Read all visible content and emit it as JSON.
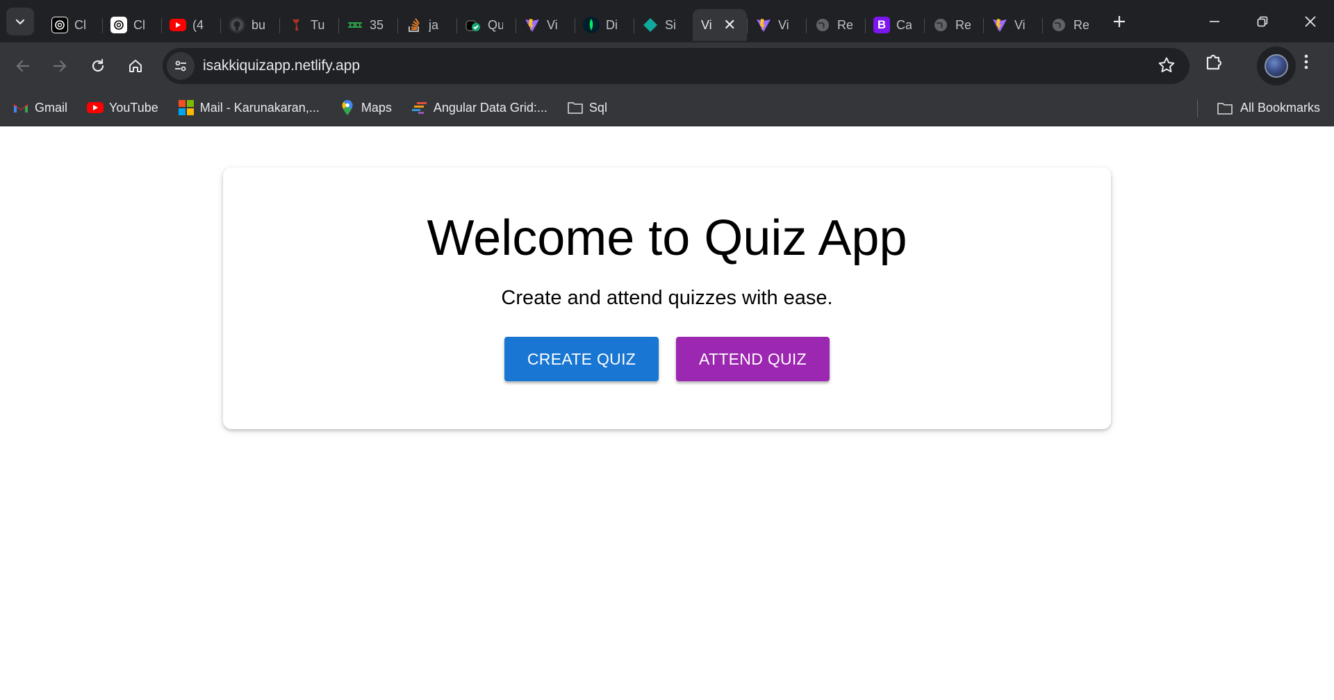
{
  "browser": {
    "tabs": [
      {
        "title": "Cl",
        "icon": "chatgpt-icon"
      },
      {
        "title": "Cl",
        "icon": "chatgpt-icon"
      },
      {
        "title": "(4",
        "icon": "youtube-icon"
      },
      {
        "title": "bu",
        "icon": "github-icon"
      },
      {
        "title": "Tu",
        "icon": "tutorial-site-icon"
      },
      {
        "title": "35",
        "icon": "leetcode-icon"
      },
      {
        "title": "ja",
        "icon": "stackoverflow-icon"
      },
      {
        "title": "Qu",
        "icon": "quiz-site-icon"
      },
      {
        "title": "Vi",
        "icon": "vite-icon"
      },
      {
        "title": "Di",
        "icon": "mongodb-icon"
      },
      {
        "title": "Si",
        "icon": "diamond-site-icon"
      },
      {
        "title": "Vi",
        "icon": "none",
        "active": true
      },
      {
        "title": "Vi",
        "icon": "vite-icon"
      },
      {
        "title": "Re",
        "icon": "globe-icon"
      },
      {
        "title": "Ca",
        "icon": "bootstrap-icon",
        "badge": "B"
      },
      {
        "title": "Re",
        "icon": "globe-icon"
      },
      {
        "title": "Vi",
        "icon": "vite-icon"
      },
      {
        "title": "Re",
        "icon": "globe-icon"
      }
    ],
    "address": {
      "url": "isakkiquizapp.netlify.app"
    },
    "bookmarks": [
      {
        "label": "Gmail",
        "icon": "gmail-icon"
      },
      {
        "label": "YouTube",
        "icon": "youtube-icon"
      },
      {
        "label": "Mail - Karunakaran,...",
        "icon": "microsoft-icon"
      },
      {
        "label": "Maps",
        "icon": "maps-pin-icon"
      },
      {
        "label": "Angular Data Grid:...",
        "icon": "ag-grid-icon"
      },
      {
        "label": "Sql",
        "icon": "folder-icon"
      }
    ],
    "all_bookmarks_label": "All Bookmarks",
    "colors": {
      "tabstrip": "#202124",
      "toolbar": "#35363a"
    }
  },
  "page": {
    "title": "Welcome to Quiz App",
    "subtitle": "Create and attend quizzes with ease.",
    "create_button": "CREATE QUIZ",
    "attend_button": "ATTEND QUIZ",
    "colors": {
      "create": "#1976d2",
      "attend": "#9c27b0"
    }
  }
}
